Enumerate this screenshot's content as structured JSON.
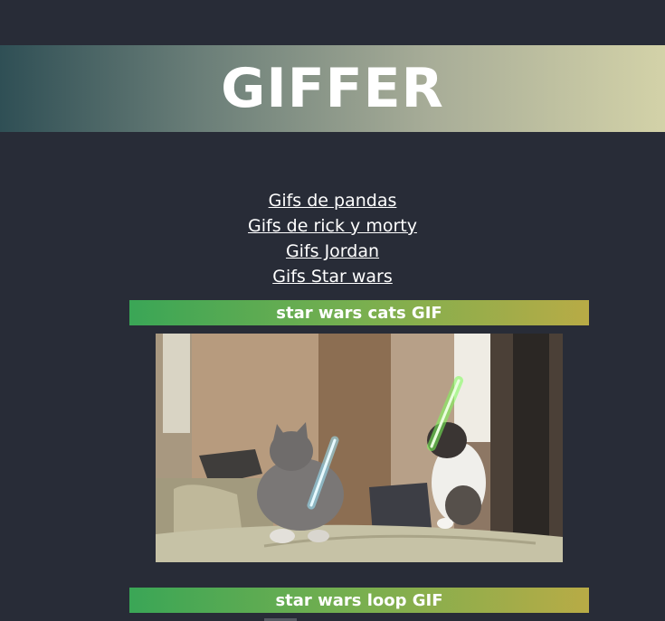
{
  "header": {
    "title": "GIFFER"
  },
  "nav": {
    "links": [
      "Gifs de pandas",
      "Gifs de rick y morty",
      "Gifs Jordan",
      "Gifs Star wars"
    ]
  },
  "gifs": [
    {
      "title": "star wars cats GIF"
    },
    {
      "title": "star wars loop GIF"
    }
  ]
}
